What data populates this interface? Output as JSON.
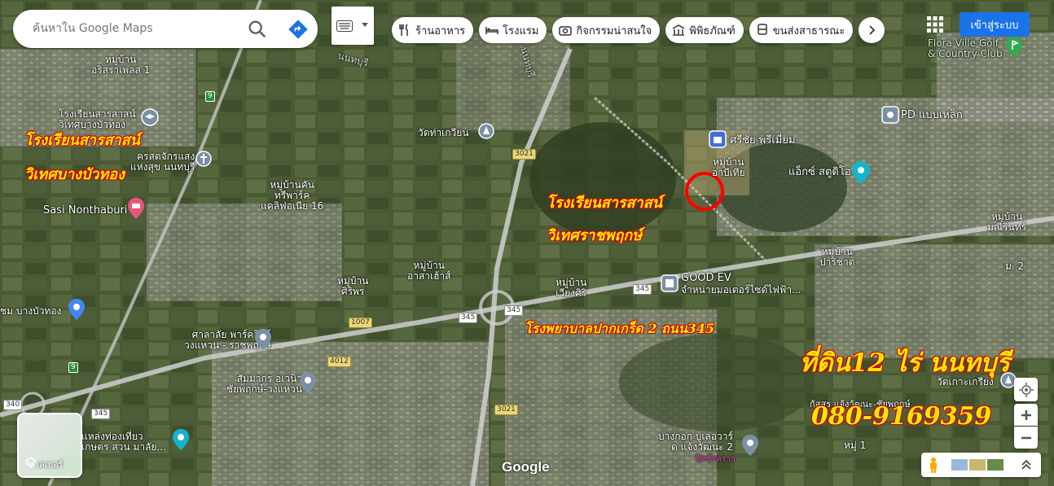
{
  "search": {
    "placeholder": "ค้นหาใน Google Maps"
  },
  "chips": [
    {
      "label": "ร้านอาหาร",
      "icon": "fork-knife-icon"
    },
    {
      "label": "โรงแรม",
      "icon": "bed-icon"
    },
    {
      "label": "กิจกรรมน่าสนใจ",
      "icon": "camera-icon"
    },
    {
      "label": "พิพิธภัณฑ์",
      "icon": "museum-icon"
    },
    {
      "label": "ขนส่งสาธารณะ",
      "icon": "bus-icon"
    }
  ],
  "signin_label": "เข้าสู่ระบบ",
  "layers_label": "เลเยอร์",
  "google_logo": "Google",
  "map_labels": {
    "village_1": "หมู่บ้าน\nอริสราเพลส 1",
    "school_small": "โรงเรียนสารสาสน์\nวิเทศบางบัวทอง",
    "church": "ครสตจักรแสง\nแห่งสุข นนทบุรี",
    "sasi": "Sasi Nonthaburi",
    "wat_tha_kwian": "วัดท่าเกวียน",
    "village_california": "หมู่บ้านคัน\nทรีพาร์ค\nแคลิฟอเนีย 16",
    "sricha": "ศรีชัย พรีเมี่ยม",
    "village_arb": "หมู่บ้าน\nอาบีเทีย",
    "pd": "PD แบบเหล็ก",
    "agent_studio": "แอ็กซ์ สตูดิโอ",
    "flora": "Flora Ville Golf\n& Country Club",
    "village_manee": "หมู่บ้าน\nมณีรินทร์",
    "village_para": "หมู่บ้าน\nปาริชาต",
    "moo2": "ม. 2",
    "good_ev": "GOOD EV",
    "good_ev_sub": "จำหน่ายมอเตอร์ไซด์ไฟฟ้า...",
    "village_asa": "หมู่บ้าน\nอาสาเฮ้าส์",
    "village_wiangsiri": "หมู่บ้าน\nเวียงศิริ",
    "village_siriporn": "หมู่บ้าน\nศิริพร",
    "bang_bua_thong": "ชม บางบัวทอง",
    "sala": "ศาลาลัย พาร์ควิลล์\nวงแหวน - ราชพฤกษ์",
    "samakkhi": "สัมมากร อเวนิว\nชัยพฤกษ์-วงแหวน",
    "tourist": "แหล่งท่องเที่ยว\nเกษตร สวน มาลัย...",
    "bangkok_boulevard": "บางกอก บูเลอวาร์\nด แจ้งวัฒนะ 2",
    "bangkok_boulevard_sub": "ปิดชั่วคราว",
    "wat_ko": "วัดเกาะเกรียง",
    "kasorn": "กัสสร แจ้งวัฒนะ-ชัยพฤกษ์",
    "moo1": "หมู่ 1",
    "nonthaburi_road": "นนทบุรี",
    "ratchaphruek_road": "นนทบุรี"
  },
  "overlay_text": {
    "school_1_line1": "โรงเรียนสารสาสน์",
    "school_1_line2": "วิเทศบางบัวทอง",
    "school_2_line1": "โรงเรียนสารสาสน์",
    "school_2_line2": "วิเทศราชพฤกษ์",
    "hospital": "โรงพยาบาลปากเกร็ด 2 ถนน345",
    "land": "ที่ดิน12 ไร่ นนทบุรี",
    "phone": "080-9169359"
  },
  "road_shields": [
    "3021",
    "3021",
    "345",
    "345",
    "345",
    "345",
    "1007",
    "4012",
    "340"
  ],
  "colors": {
    "accent": "#1a73e8",
    "overlay_text": "#ffe600",
    "marker_circle": "#ff0000"
  }
}
